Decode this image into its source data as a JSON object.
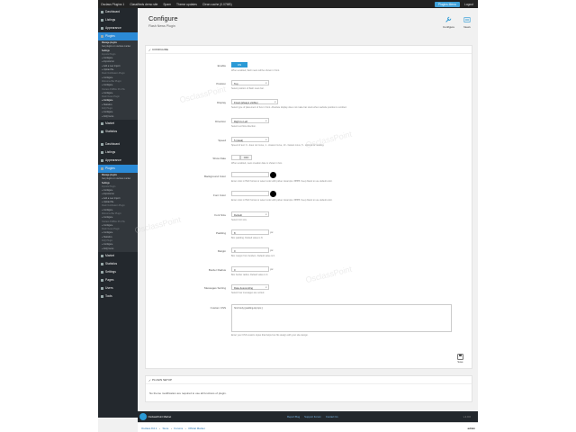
{
  "topbar": {
    "items": [
      "Osclass Plugins 1",
      "Classifieds demo site",
      "Spam",
      "Theme updates",
      "Clean cache (0.07MB)"
    ],
    "plugins_menu": "Plugins Menu",
    "logout": "Logout"
  },
  "sidebar": {
    "top_items": [
      "Dashboard",
      "Listings",
      "Appearance",
      "Plugins"
    ],
    "submenu": [
      {
        "label": "Manage plugins",
        "state": "on"
      },
      {
        "label": "Get plugins on osclass.market",
        "state": ""
      },
      {
        "label": "Settings",
        "state": "on"
      },
      {
        "label": "Imports Plugin",
        "state": "hd"
      },
      {
        "label": "» Configure",
        "state": ""
      },
      {
        "label": "» Imports list",
        "state": ""
      },
      {
        "label": "» Add a new import",
        "state": ""
      },
      {
        "label": "» Upload file",
        "state": ""
      },
      {
        "label": "Flash Notification Plugin",
        "state": "hd"
      },
      {
        "label": "» Configure",
        "state": ""
      },
      {
        "label": "Welcome Bar Plugin",
        "state": "hd"
      },
      {
        "label": "» Configure",
        "state": ""
      },
      {
        "label": "Osclass PollBox Pro Plu",
        "state": "hd"
      },
      {
        "label": "» Configure",
        "state": ""
      },
      {
        "label": "Flash News Plugin",
        "state": "hd"
      },
      {
        "label": "» Configure",
        "state": "on"
      },
      {
        "label": "» Statistics",
        "state": ""
      },
      {
        "label": "FAQ Plugin",
        "state": "hd"
      },
      {
        "label": "» Configure",
        "state": ""
      },
      {
        "label": "» FAQ Items",
        "state": ""
      }
    ],
    "bottom_items": [
      "Market",
      "Statistics"
    ]
  },
  "header": {
    "title": "Configure",
    "subtitle": "Flash News Plugin",
    "configure_label": "Configure",
    "news_label": "News"
  },
  "panel": {
    "title": "CONFIGURE",
    "save_label": "Save",
    "fields": {
      "enable": {
        "label": "Enable",
        "value": "ON",
        "help": "When enabled, flash news will be shown in front."
      },
      "position": {
        "label": "Position",
        "value": "Top",
        "help": "Select position of flash news bar."
      },
      "display": {
        "label": "Display",
        "value": "Fixed (always visible)",
        "help": "Select type of placement of box in front. Absolute display does not make bar stuck when website position is scrolled."
      },
      "direction": {
        "label": "Direction",
        "value": "Right to Left",
        "help": "Select text flow direction."
      },
      "speed": {
        "label": "Speed",
        "value": "5 (ideal)",
        "help": "Speed of text: 0 - does not move, 1 - slowest move, 10 - fastest move, 5 - optimal for reading."
      },
      "show_date": {
        "label": "Show Date",
        "value": "OFF",
        "help": "When enabled, news creation date is shown in box."
      },
      "background_color": {
        "label": "Background Color",
        "help": "Enter color in HEX format or select color with picker. Example: #ffffffff. Keep blank to use default color."
      },
      "font_color": {
        "label": "Font Color",
        "help": "Enter color in HEX format or select color with picker. Example: #ffffffff. Keep blank to use default color."
      },
      "font_size": {
        "label": "Font Size",
        "value": "Default",
        "help": "Select font size."
      },
      "padding": {
        "label": "Padding",
        "value": "8",
        "unit": "px",
        "help": "Box padding. Default value is 8."
      },
      "margin": {
        "label": "Margin",
        "value": "0",
        "unit": "px",
        "help": "Box margin from borders. Default value is 0."
      },
      "border_radius": {
        "label": "Border Radius",
        "value": "0",
        "unit": "px",
        "help": "Box border radius. Default value is 0."
      },
      "messages_sorting": {
        "label": "Messages Sorting",
        "value": "Date descending",
        "help": "Select how messages are sorted."
      },
      "custom_css": {
        "label": "Custom CSS",
        "value": "html body {padding-top:1px;}",
        "help": "Enter your CSS custom styles that helps box fits design with your site design."
      }
    }
  },
  "sidebar2": {
    "top_items": [
      "Dashboard",
      "Listings",
      "Appearance",
      "Plugins"
    ],
    "submenu": [
      {
        "label": "Manage plugins",
        "state": "on"
      },
      {
        "label": "Get plugins on osclass.market",
        "state": ""
      },
      {
        "label": "Settings",
        "state": "on"
      },
      {
        "label": "Imports Plugin",
        "state": "hd"
      },
      {
        "label": "» Configure",
        "state": ""
      },
      {
        "label": "» Imports list",
        "state": ""
      },
      {
        "label": "» Add a new import",
        "state": ""
      },
      {
        "label": "» Upload file",
        "state": ""
      },
      {
        "label": "Flash Notification Plugin",
        "state": "hd"
      },
      {
        "label": "» Configure",
        "state": ""
      },
      {
        "label": "Welcome Bar Plugin",
        "state": "hd"
      },
      {
        "label": "» Configure",
        "state": ""
      },
      {
        "label": "Osclass PollBox Pro Plu",
        "state": "hd"
      },
      {
        "label": "» Configure",
        "state": ""
      },
      {
        "label": "Flash News Plugin",
        "state": "hd"
      },
      {
        "label": "» Configure",
        "state": ""
      },
      {
        "label": "» Statistics",
        "state": ""
      },
      {
        "label": "FAQ Plugin",
        "state": "hd"
      },
      {
        "label": "» Configure",
        "state": ""
      },
      {
        "label": "» FAQ Items",
        "state": ""
      }
    ],
    "bottom_items": [
      "Market",
      "Statistics",
      "Settings",
      "Pages",
      "Users",
      "Tools"
    ]
  },
  "setup": {
    "title": "PLUGIN SETUP",
    "text": "No theme modification are required to use all functions of plugin."
  },
  "footer": {
    "brand": "OsclassPoint Market",
    "links": [
      "Report Bug",
      "Support Forum",
      "Contact Us"
    ],
    "version": "v.1.0.0"
  },
  "breadcrumb": {
    "items": [
      "Osclass 8.0.1",
      "Store",
      "Forums",
      "Official Market"
    ],
    "user": "admin"
  },
  "watermark": "OsclassPoint",
  "colors": {
    "accent": "#2b9ad6",
    "sidebar": "#23282d"
  }
}
